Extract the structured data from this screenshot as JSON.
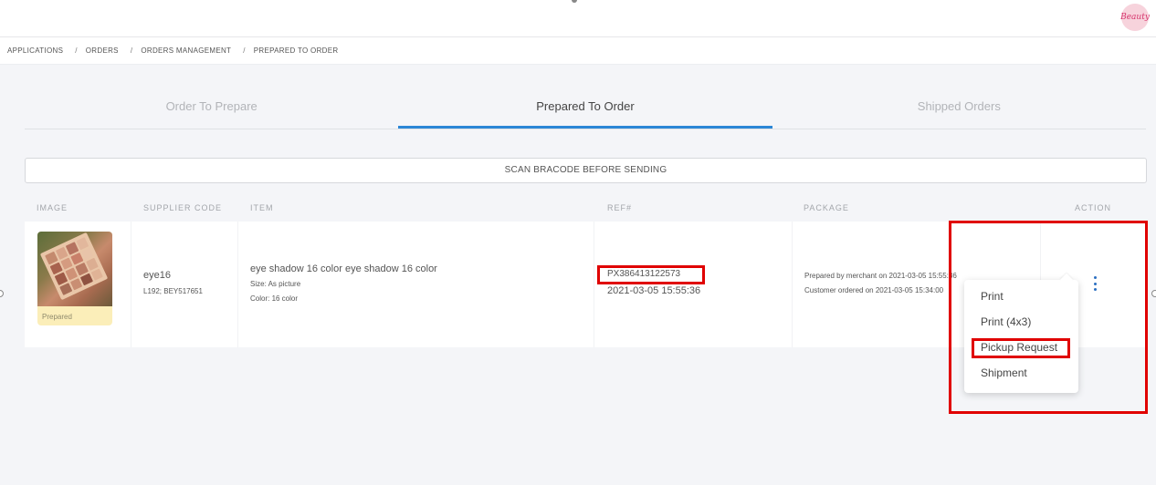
{
  "brand": {
    "logo_text": "Beauty"
  },
  "breadcrumb": {
    "items": [
      "APPLICATIONS",
      "ORDERS",
      "ORDERS MANAGEMENT",
      "PREPARED TO ORDER"
    ],
    "separator": "/"
  },
  "tabs": [
    {
      "label": "Order To Prepare",
      "active": false
    },
    {
      "label": "Prepared To Order",
      "active": true
    },
    {
      "label": "Shipped Orders",
      "active": false
    }
  ],
  "scan_button": {
    "label": "SCAN BRACODE BEFORE SENDING"
  },
  "table": {
    "headers": [
      "IMAGE",
      "SUPPLIER CODE",
      "ITEM",
      "REF#",
      "PACKAGE",
      "ACTION"
    ],
    "rows": [
      {
        "image_label": "Prepared",
        "supplier_code": "eye16",
        "supplier_sub": "L192; BEY517651",
        "item_title": "eye shadow 16 color  eye shadow 16 color",
        "item_size": "Size: As picture",
        "item_color": "Color: 16 color",
        "ref_id": "PX386413122573",
        "ref_date": "2021-03-05 15:55:36",
        "package_prepared": "Prepared by merchant on 2021-03-05 15:55:36",
        "package_ordered": "Customer ordered on 2021-03-05 15:34:00"
      }
    ]
  },
  "action_menu": {
    "items": [
      "Print",
      "Print (4x3)",
      "Pickup Request",
      "Shipment"
    ]
  },
  "colors": {
    "accent": "#2b86d6",
    "highlight": "#e00000",
    "prepared_badge": "#fbeeb9"
  }
}
